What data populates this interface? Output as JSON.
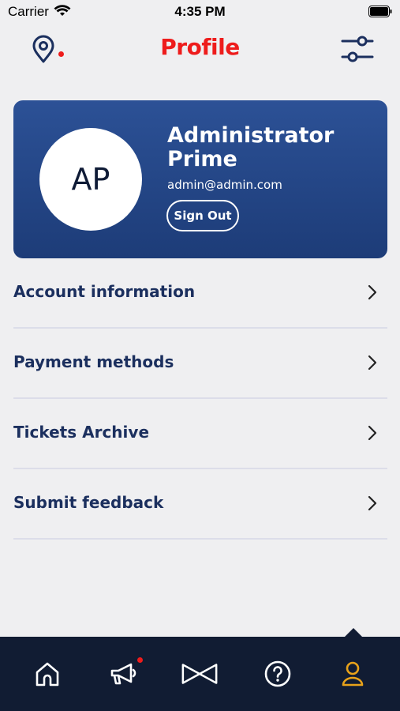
{
  "status_bar": {
    "carrier": "Carrier",
    "time": "4:35 PM"
  },
  "header": {
    "title": "Profile",
    "left_icon": "location-pin-icon",
    "right_icon": "filter-sliders-icon",
    "title_color": "#ee1c1c"
  },
  "profile": {
    "initials": "AP",
    "name": "Administrator Prime",
    "email": "admin@admin.com",
    "sign_out_label": "Sign Out",
    "card_color": "#2c5196"
  },
  "menu": {
    "items": [
      {
        "label": "Account information"
      },
      {
        "label": "Payment methods"
      },
      {
        "label": "Tickets Archive"
      },
      {
        "label": "Submit feedback"
      }
    ]
  },
  "tab_bar": {
    "tabs": [
      {
        "icon": "home-icon",
        "active": false
      },
      {
        "icon": "megaphone-icon",
        "active": false,
        "badge": true
      },
      {
        "icon": "bowtie-icon",
        "active": false
      },
      {
        "icon": "help-icon",
        "active": false
      },
      {
        "icon": "user-icon",
        "active": true
      }
    ],
    "active_color": "#e8a21a",
    "background": "#111c33"
  }
}
